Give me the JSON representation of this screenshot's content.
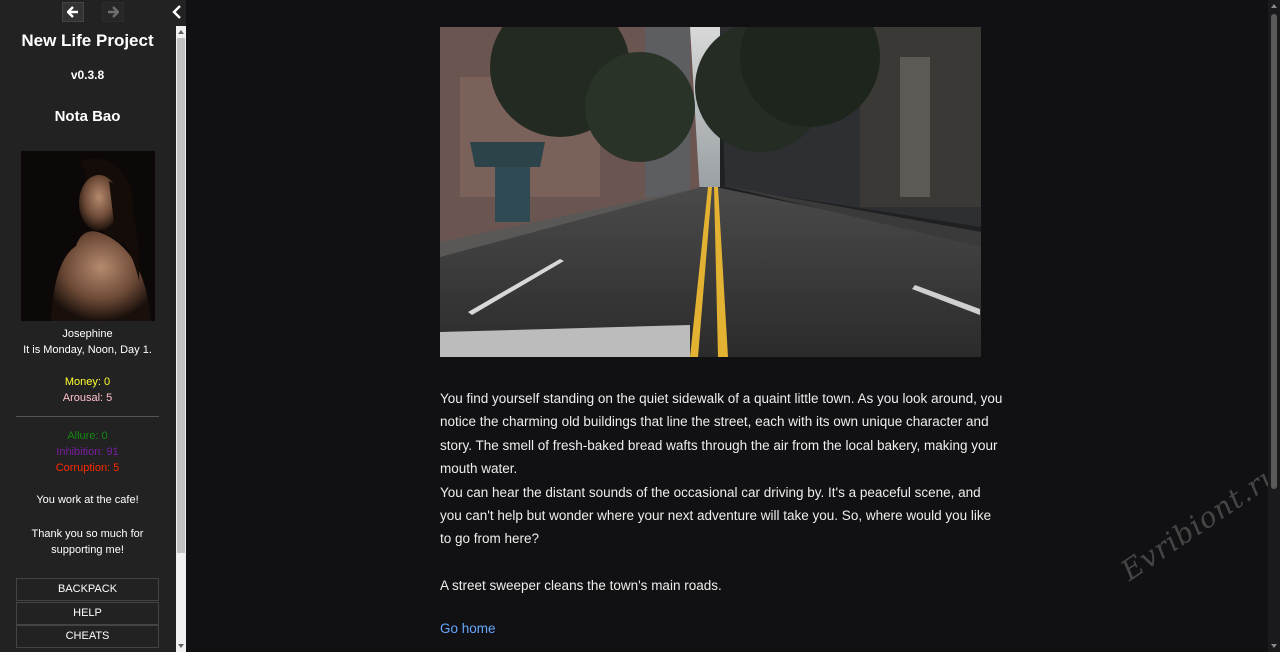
{
  "sidebar": {
    "title": "New Life Project",
    "version": "v0.3.8",
    "player_name": "Nota Bao",
    "portrait_caption": "Josephine",
    "time_text": "It is Monday, Noon, Day 1.",
    "money": "Money: 0",
    "arousal": "Arousal: 5",
    "allure": "Allure: 0",
    "inhibition": "Inhibition: 91",
    "corruption": "Corruption: 5",
    "job": "You work at the cafe!",
    "thanks": "Thank you so much for supporting me!",
    "buttons": {
      "backpack": "BACKPACK",
      "help": "HELP",
      "cheats": "CHEATS"
    }
  },
  "passage": {
    "paragraph1": "You find yourself standing on the quiet sidewalk of a quaint little town. As you look around, you notice the charming old buildings that line the street, each with its own unique character and story. The smell of fresh-baked bread wafts through the air from the local bakery, making your mouth water.",
    "paragraph2": "You can hear the distant sounds of the occasional car driving by. It's a peaceful scene, and you can't help but wonder where your next adventure will take you. So, where would you like to go from here?",
    "paragraph3": "A street sweeper cleans the town's main roads.",
    "link": "Go home"
  },
  "watermark": "Evribiont.ru",
  "colors": {
    "sidebar_bg": "#222222",
    "page_bg": "#111113",
    "money": "#ffff33",
    "arousal": "#ffc0cb",
    "allure": "#138a13",
    "inhibition": "#7a1ea1",
    "corruption": "#ff2a00",
    "link": "#68a7ff"
  }
}
